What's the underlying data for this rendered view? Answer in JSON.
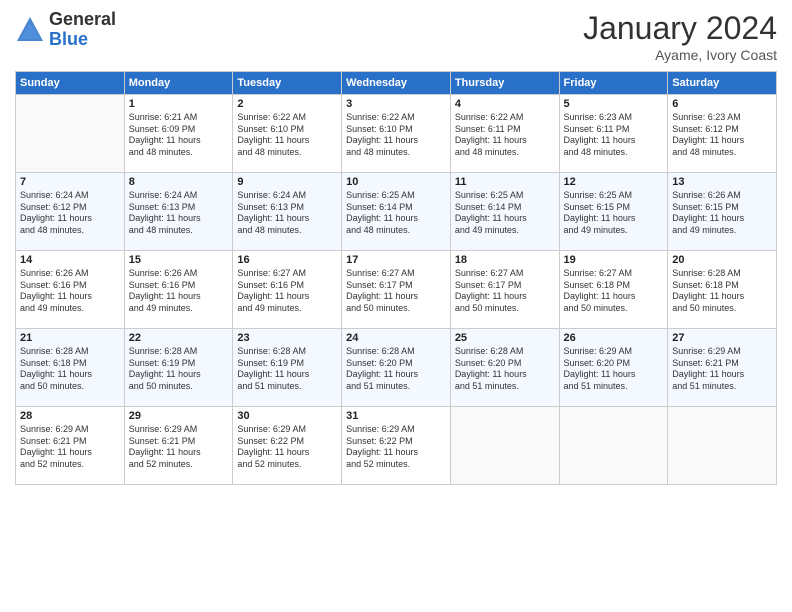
{
  "logo": {
    "general": "General",
    "blue": "Blue"
  },
  "title": "January 2024",
  "location": "Ayame, Ivory Coast",
  "days_of_week": [
    "Sunday",
    "Monday",
    "Tuesday",
    "Wednesday",
    "Thursday",
    "Friday",
    "Saturday"
  ],
  "weeks": [
    [
      {
        "day": "",
        "info": ""
      },
      {
        "day": "1",
        "info": "Sunrise: 6:21 AM\nSunset: 6:09 PM\nDaylight: 11 hours\nand 48 minutes."
      },
      {
        "day": "2",
        "info": "Sunrise: 6:22 AM\nSunset: 6:10 PM\nDaylight: 11 hours\nand 48 minutes."
      },
      {
        "day": "3",
        "info": "Sunrise: 6:22 AM\nSunset: 6:10 PM\nDaylight: 11 hours\nand 48 minutes."
      },
      {
        "day": "4",
        "info": "Sunrise: 6:22 AM\nSunset: 6:11 PM\nDaylight: 11 hours\nand 48 minutes."
      },
      {
        "day": "5",
        "info": "Sunrise: 6:23 AM\nSunset: 6:11 PM\nDaylight: 11 hours\nand 48 minutes."
      },
      {
        "day": "6",
        "info": "Sunrise: 6:23 AM\nSunset: 6:12 PM\nDaylight: 11 hours\nand 48 minutes."
      }
    ],
    [
      {
        "day": "7",
        "info": "Sunrise: 6:24 AM\nSunset: 6:12 PM\nDaylight: 11 hours\nand 48 minutes."
      },
      {
        "day": "8",
        "info": "Sunrise: 6:24 AM\nSunset: 6:13 PM\nDaylight: 11 hours\nand 48 minutes."
      },
      {
        "day": "9",
        "info": "Sunrise: 6:24 AM\nSunset: 6:13 PM\nDaylight: 11 hours\nand 48 minutes."
      },
      {
        "day": "10",
        "info": "Sunrise: 6:25 AM\nSunset: 6:14 PM\nDaylight: 11 hours\nand 48 minutes."
      },
      {
        "day": "11",
        "info": "Sunrise: 6:25 AM\nSunset: 6:14 PM\nDaylight: 11 hours\nand 49 minutes."
      },
      {
        "day": "12",
        "info": "Sunrise: 6:25 AM\nSunset: 6:15 PM\nDaylight: 11 hours\nand 49 minutes."
      },
      {
        "day": "13",
        "info": "Sunrise: 6:26 AM\nSunset: 6:15 PM\nDaylight: 11 hours\nand 49 minutes."
      }
    ],
    [
      {
        "day": "14",
        "info": "Sunrise: 6:26 AM\nSunset: 6:16 PM\nDaylight: 11 hours\nand 49 minutes."
      },
      {
        "day": "15",
        "info": "Sunrise: 6:26 AM\nSunset: 6:16 PM\nDaylight: 11 hours\nand 49 minutes."
      },
      {
        "day": "16",
        "info": "Sunrise: 6:27 AM\nSunset: 6:16 PM\nDaylight: 11 hours\nand 49 minutes."
      },
      {
        "day": "17",
        "info": "Sunrise: 6:27 AM\nSunset: 6:17 PM\nDaylight: 11 hours\nand 50 minutes."
      },
      {
        "day": "18",
        "info": "Sunrise: 6:27 AM\nSunset: 6:17 PM\nDaylight: 11 hours\nand 50 minutes."
      },
      {
        "day": "19",
        "info": "Sunrise: 6:27 AM\nSunset: 6:18 PM\nDaylight: 11 hours\nand 50 minutes."
      },
      {
        "day": "20",
        "info": "Sunrise: 6:28 AM\nSunset: 6:18 PM\nDaylight: 11 hours\nand 50 minutes."
      }
    ],
    [
      {
        "day": "21",
        "info": "Sunrise: 6:28 AM\nSunset: 6:18 PM\nDaylight: 11 hours\nand 50 minutes."
      },
      {
        "day": "22",
        "info": "Sunrise: 6:28 AM\nSunset: 6:19 PM\nDaylight: 11 hours\nand 50 minutes."
      },
      {
        "day": "23",
        "info": "Sunrise: 6:28 AM\nSunset: 6:19 PM\nDaylight: 11 hours\nand 51 minutes."
      },
      {
        "day": "24",
        "info": "Sunrise: 6:28 AM\nSunset: 6:20 PM\nDaylight: 11 hours\nand 51 minutes."
      },
      {
        "day": "25",
        "info": "Sunrise: 6:28 AM\nSunset: 6:20 PM\nDaylight: 11 hours\nand 51 minutes."
      },
      {
        "day": "26",
        "info": "Sunrise: 6:29 AM\nSunset: 6:20 PM\nDaylight: 11 hours\nand 51 minutes."
      },
      {
        "day": "27",
        "info": "Sunrise: 6:29 AM\nSunset: 6:21 PM\nDaylight: 11 hours\nand 51 minutes."
      }
    ],
    [
      {
        "day": "28",
        "info": "Sunrise: 6:29 AM\nSunset: 6:21 PM\nDaylight: 11 hours\nand 52 minutes."
      },
      {
        "day": "29",
        "info": "Sunrise: 6:29 AM\nSunset: 6:21 PM\nDaylight: 11 hours\nand 52 minutes."
      },
      {
        "day": "30",
        "info": "Sunrise: 6:29 AM\nSunset: 6:22 PM\nDaylight: 11 hours\nand 52 minutes."
      },
      {
        "day": "31",
        "info": "Sunrise: 6:29 AM\nSunset: 6:22 PM\nDaylight: 11 hours\nand 52 minutes."
      },
      {
        "day": "",
        "info": ""
      },
      {
        "day": "",
        "info": ""
      },
      {
        "day": "",
        "info": ""
      }
    ]
  ]
}
